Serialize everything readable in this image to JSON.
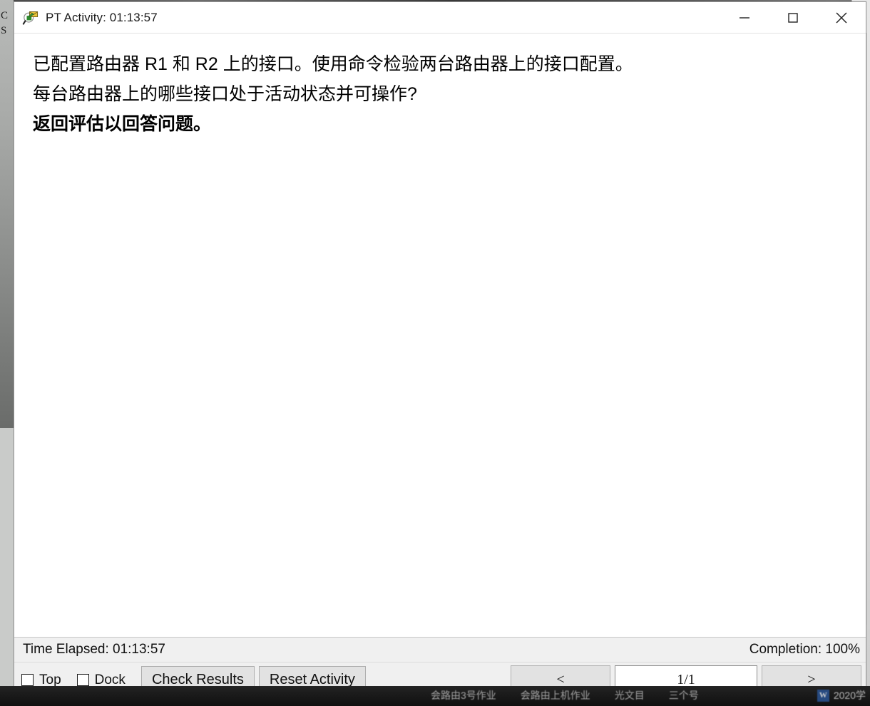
{
  "window": {
    "title": "PT Activity: 01:13:57",
    "icon": "magnifier-envelope-icon",
    "controls": {
      "minimize_label": "Minimize",
      "maximize_label": "Maximize",
      "close_label": "Close"
    }
  },
  "content": {
    "lines": [
      {
        "text": "已配置路由器 R1 和 R2 上的接口。使用命令检验两台路由器上的接口配置。",
        "bold": false
      },
      {
        "text": "每台路由器上的哪些接口处于活动状态并可操作?",
        "bold": false
      },
      {
        "text": "返回评估以回答问题。",
        "bold": true
      }
    ]
  },
  "status": {
    "time_elapsed": "Time Elapsed: 01:13:57",
    "completion": "Completion: 100%"
  },
  "toolbar": {
    "top_checkbox_label": "Top",
    "top_checked": false,
    "dock_checkbox_label": "Dock",
    "dock_checked": false,
    "check_results_label": "Check Results",
    "reset_activity_label": "Reset Activity",
    "prev_label": "<",
    "next_label": ">",
    "page_indicator": "1/1"
  },
  "background": {
    "left_window_letters": "C\nS",
    "right_window_percent": "%",
    "taskbar_items": [
      "会路由3号作业",
      "会路由上机作业",
      "光文目",
      "三个号"
    ],
    "taskbar_right_label": "2020学"
  }
}
